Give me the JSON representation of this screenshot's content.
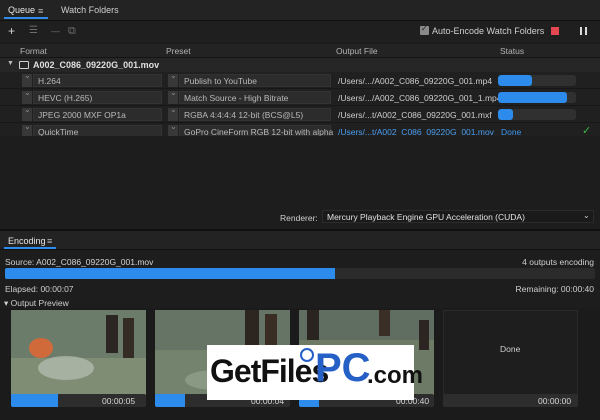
{
  "tabs": {
    "queue": "Queue",
    "queue_menu": "≡",
    "watch_folders": "Watch Folders"
  },
  "toolbar": {
    "add_icon": "+",
    "settings_icon": "☰",
    "remove_icon": "—",
    "duplicate_icon": "⧉",
    "auto_encode_label": "Auto-Encode Watch Folders",
    "auto_encode_checked": true,
    "stop_color": "#e34850"
  },
  "columns": {
    "format": "Format",
    "preset": "Preset",
    "output_file": "Output File",
    "status": "Status"
  },
  "queue": {
    "source_name": "A002_C086_09220G_001.mov",
    "items": [
      {
        "format": "H.264",
        "preset": "Publish to YouTube",
        "output": "/Users/.../A002_C086_09220G_001.mp4",
        "progress": 0.44
      },
      {
        "format": "HEVC (H.265)",
        "preset": "Match Source - High Bitrate",
        "output": "/Users/.../A002_C086_09220G_001_1.mp4",
        "progress": 0.88
      },
      {
        "format": "JPEG 2000 MXF OP1a",
        "preset": "RGBA 4:4:4:4 12-bit (BCS@L5)",
        "output": "/Users/...t/A002_C086_09220G_001.mxf",
        "progress": 0.19
      },
      {
        "format": "QuickTime",
        "preset": "GoPro CineForm RGB 12-bit with alpha",
        "output": "/Users/...t/A002_C086_09220G_001.mov",
        "status": "Done"
      }
    ]
  },
  "renderer": {
    "label": "Renderer:",
    "value": "Mercury Playback Engine GPU Acceleration (CUDA)"
  },
  "encoding": {
    "tab": "Encoding",
    "menu": "≡",
    "source": "Source: A002_C086_09220G_001.mov",
    "outputs_count": "4 outputs encoding",
    "progress": 0.56,
    "elapsed": "Elapsed: 00:00:07",
    "remaining": "Remaining: 00:00:40",
    "preview_title": "Output Preview",
    "previews": [
      {
        "time": "00:00:05",
        "progress": 0.35
      },
      {
        "time": "00:00:04",
        "progress": 0.22
      },
      {
        "time": "00:00:40",
        "progress": 0.15
      },
      {
        "label": "Done",
        "time": "00:00:00",
        "progress": 0.0
      }
    ]
  },
  "watermark": {
    "get_files": "GetFiles",
    "pc": "PC",
    "com": ".com"
  },
  "colors": {
    "accent": "#2d8ceb",
    "done_green": "#3cb846"
  }
}
